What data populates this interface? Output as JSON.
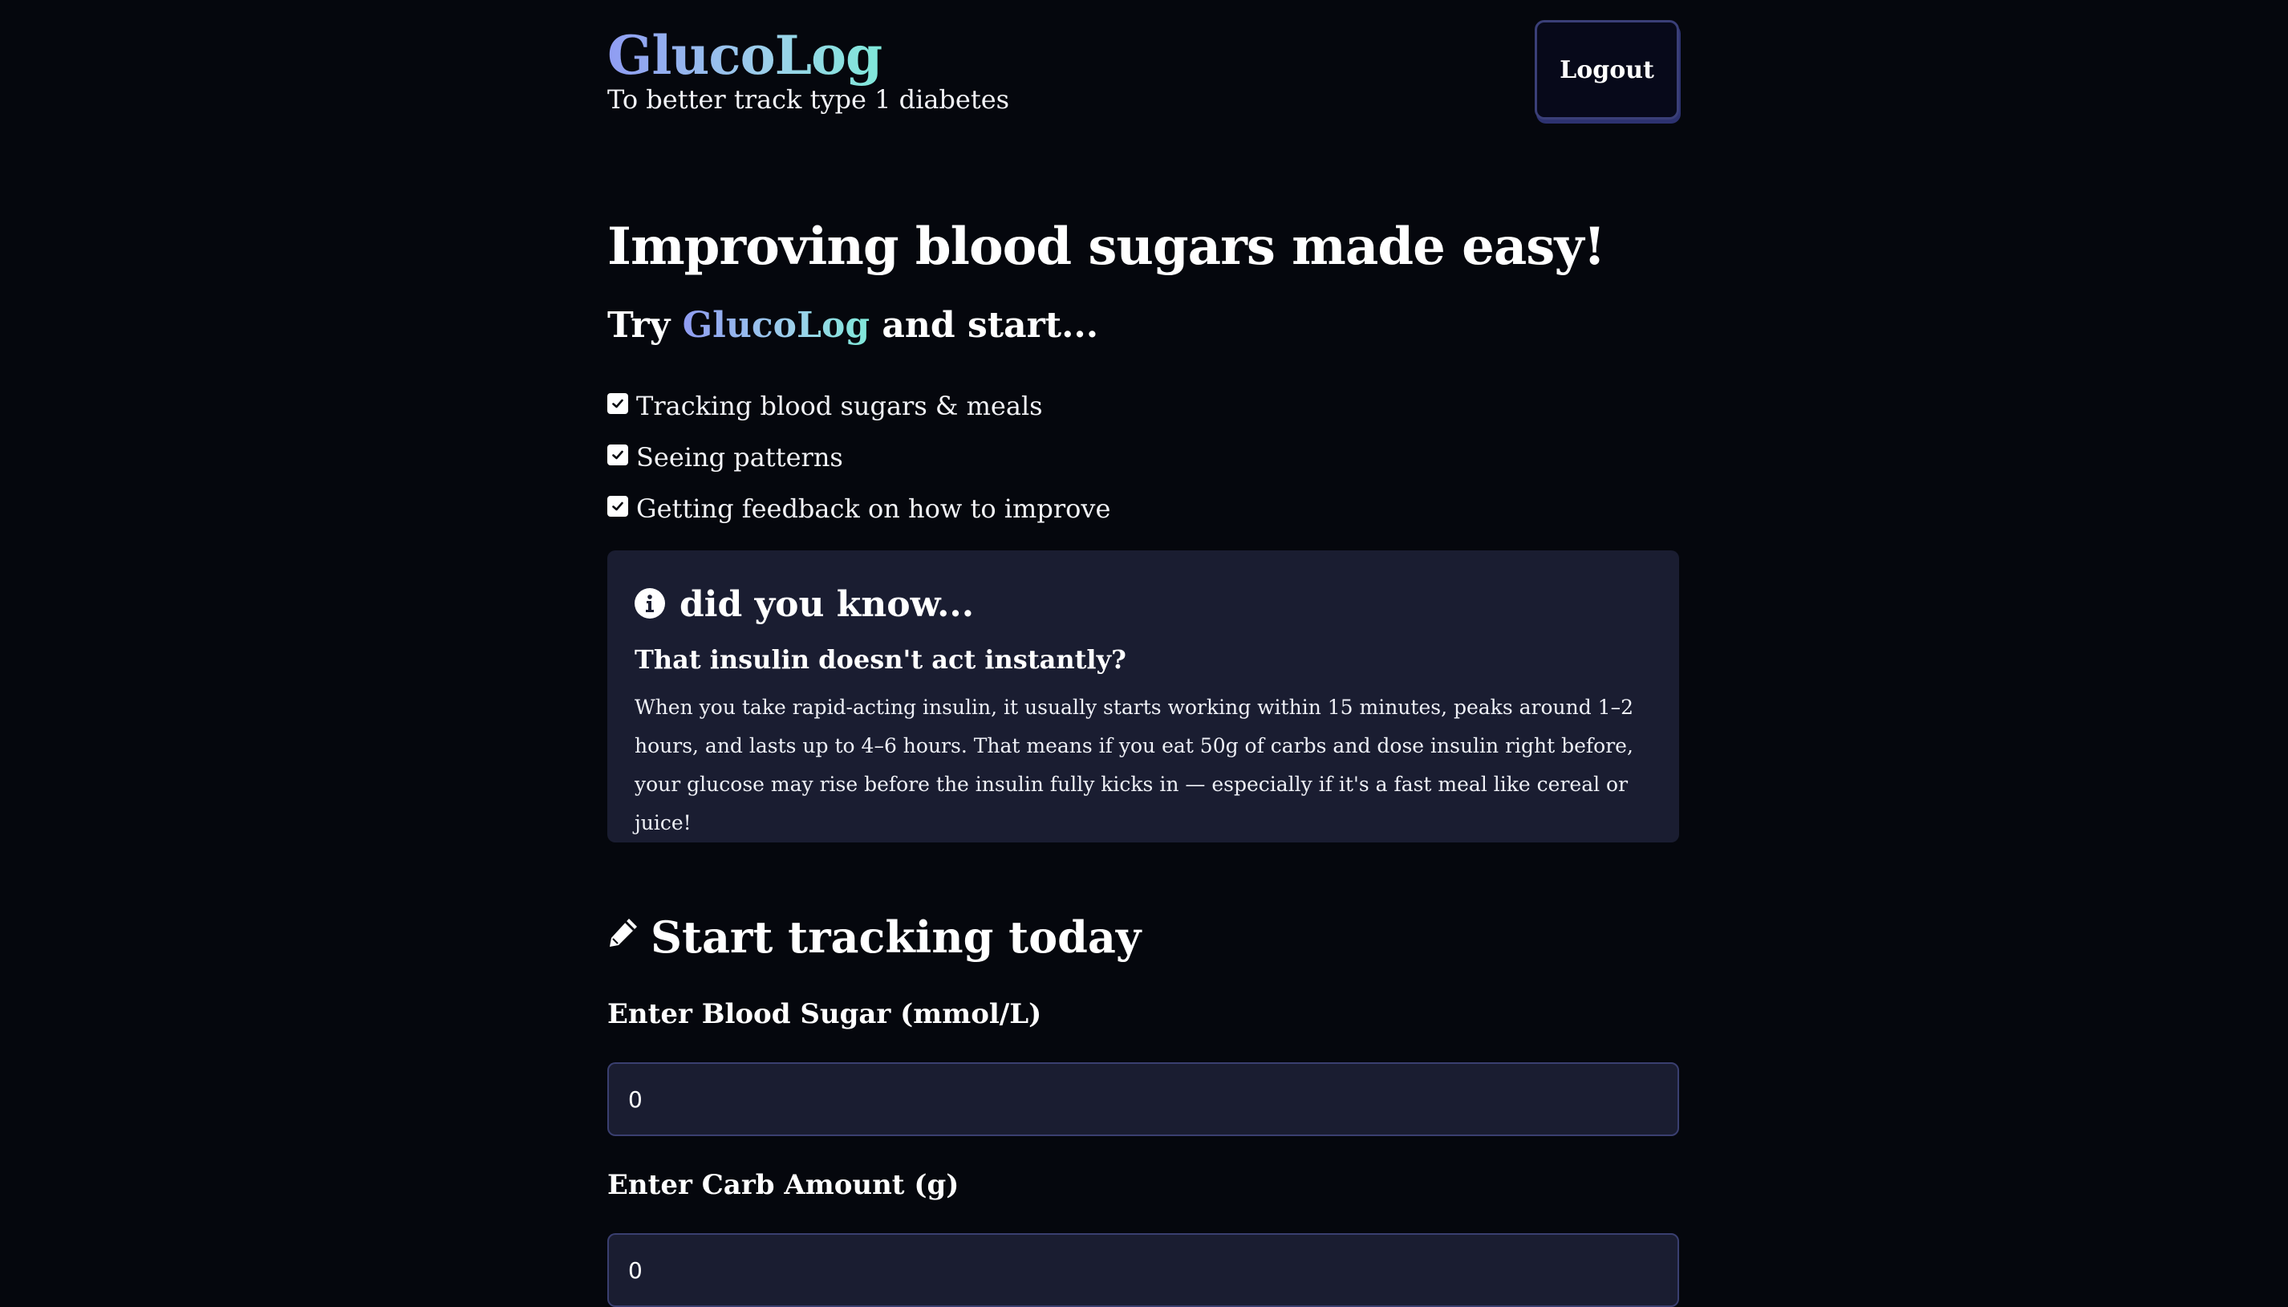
{
  "header": {
    "brand": "GlucoLog",
    "tagline": "To better track type 1 diabetes",
    "logout_label": "Logout"
  },
  "hero": {
    "title": "Improving blood sugars made easy!",
    "sub_prefix": "Try ",
    "sub_accent": "GlucoLog",
    "sub_suffix": " and start..."
  },
  "checklist": [
    "Tracking blood sugars & meals",
    "Seeing patterns",
    "Getting feedback on how to improve"
  ],
  "info": {
    "icon": "info-circle-icon",
    "heading": "did you know...",
    "question": "That insulin doesn't act instantly?",
    "body": "When you take rapid-acting insulin, it usually starts working within 15 minutes, peaks around 1–2 hours, and lasts up to 4–6 hours. That means if you eat 50g of carbs and dose insulin right before, your glucose may rise before the insulin fully kicks in — especially if it's a fast meal like cereal or juice!"
  },
  "tracking": {
    "icon": "pencil-icon",
    "title": "Start tracking today",
    "blood_sugar_label": "Enter Blood Sugar (mmol/L)",
    "blood_sugar_value": "0",
    "carb_label": "Enter Carb Amount (g)",
    "carb_value": "0"
  },
  "colors": {
    "background": "#05070d",
    "card": "#1a1d31",
    "accent_gradient_start": "#8f9cf2",
    "accent_gradient_end": "#7fe8d9"
  }
}
